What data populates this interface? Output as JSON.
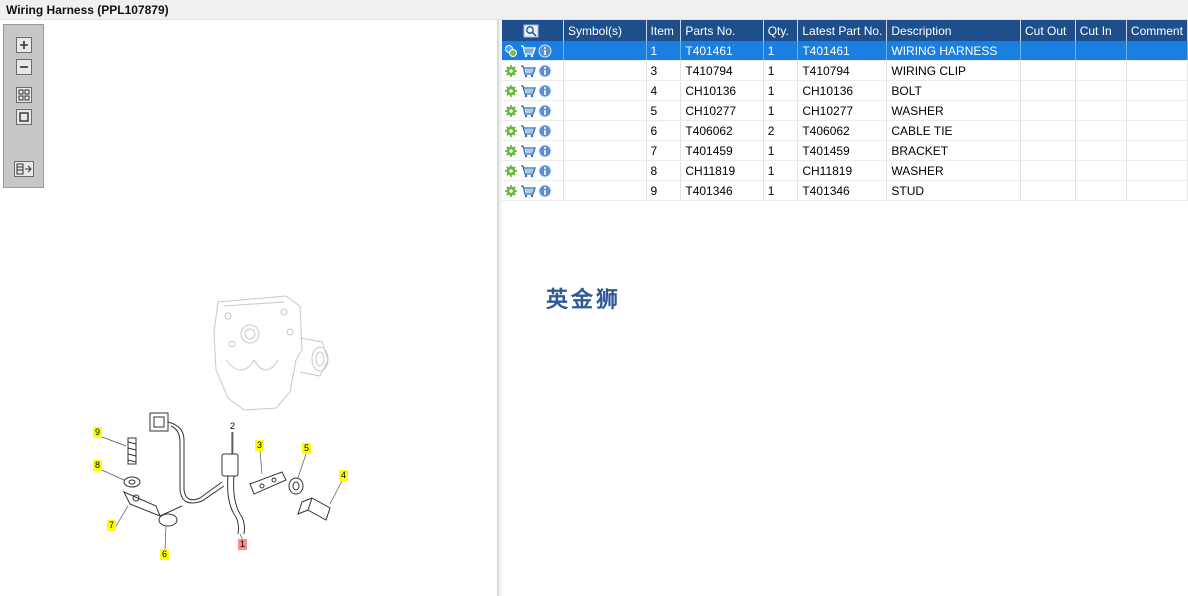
{
  "window": {
    "title": "Wiring Harness (PPL107879)"
  },
  "toolbox": {
    "buttons": [
      {
        "name": "zoom-in-icon"
      },
      {
        "name": "zoom-out-icon"
      },
      {
        "name": "fit-all-icon"
      },
      {
        "name": "fit-window-icon"
      },
      {
        "name": "export-list-icon"
      }
    ]
  },
  "diagram": {
    "callouts": [
      {
        "label": "9",
        "highlight": "yellow"
      },
      {
        "label": "8",
        "highlight": "yellow"
      },
      {
        "label": "7",
        "highlight": "yellow"
      },
      {
        "label": "6",
        "highlight": "yellow"
      },
      {
        "label": "2",
        "highlight": "none"
      },
      {
        "label": "3",
        "highlight": "yellow"
      },
      {
        "label": "5",
        "highlight": "yellow"
      },
      {
        "label": "4",
        "highlight": "yellow"
      },
      {
        "label": "1",
        "highlight": "red"
      }
    ]
  },
  "parts_table": {
    "columns": [
      "Symbol(s)",
      "Item",
      "Parts No.",
      "Qty.",
      "Latest Part No.",
      "Description",
      "Cut Out",
      "Cut In",
      "Comment"
    ],
    "rows": [
      {
        "item": "1",
        "parts_no": "T401461",
        "qty": "1",
        "latest": "T401461",
        "description": "WIRING HARNESS",
        "selected": true
      },
      {
        "item": "3",
        "parts_no": "T410794",
        "qty": "1",
        "latest": "T410794",
        "description": "WIRING CLIP",
        "selected": false
      },
      {
        "item": "4",
        "parts_no": "CH10136",
        "qty": "1",
        "latest": "CH10136",
        "description": "BOLT",
        "selected": false
      },
      {
        "item": "5",
        "parts_no": "CH10277",
        "qty": "1",
        "latest": "CH10277",
        "description": "WASHER",
        "selected": false
      },
      {
        "item": "6",
        "parts_no": "T406062",
        "qty": "2",
        "latest": "T406062",
        "description": "CABLE TIE",
        "selected": false
      },
      {
        "item": "7",
        "parts_no": "T401459",
        "qty": "1",
        "latest": "T401459",
        "description": "BRACKET",
        "selected": false
      },
      {
        "item": "8",
        "parts_no": "CH11819",
        "qty": "1",
        "latest": "CH11819",
        "description": "WASHER",
        "selected": false
      },
      {
        "item": "9",
        "parts_no": "T401346",
        "qty": "1",
        "latest": "T401346",
        "description": "STUD",
        "selected": false
      }
    ]
  },
  "watermark": {
    "text": "英金狮"
  },
  "colors": {
    "header_bg": "#1f4e8c",
    "selected_row": "#1a7fe0",
    "callout_yellow": "#ffff00",
    "callout_red": "#ff8a8a",
    "watermark": "#2d5a96"
  }
}
